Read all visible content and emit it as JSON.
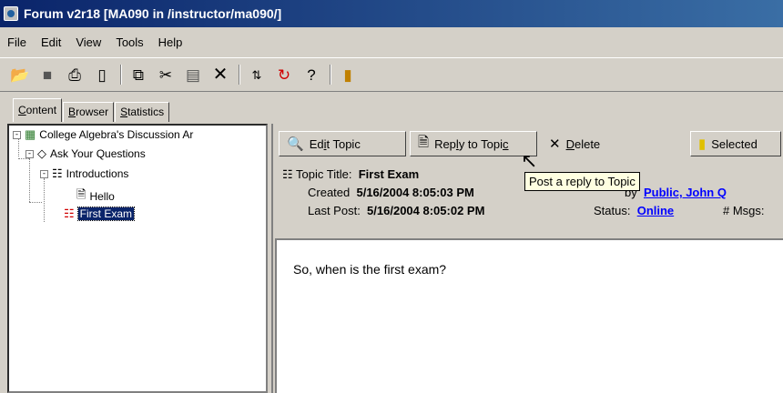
{
  "window": {
    "title": "Forum v2r18  [MA090 in /instructor/ma090/]"
  },
  "menu": [
    "File",
    "Edit",
    "View",
    "Tools",
    "Help"
  ],
  "toolbar": {
    "icons": [
      "open-folder-icon",
      "save-icon",
      "print-icon",
      "folder-icon",
      "copy-icon",
      "cut-icon",
      "paste-icon",
      "delete-icon",
      "sort-icon",
      "refresh-icon",
      "help-icon",
      "exit-icon"
    ]
  },
  "tabs": [
    {
      "label_underline": "C",
      "label_rest": "ontent"
    },
    {
      "label_underline": "B",
      "label_rest": "rowser"
    },
    {
      "label_underline": "S",
      "label_rest": "tatistics"
    }
  ],
  "tree": {
    "root": "College Algebra's Discussion Ar",
    "section": "Ask Your Questions",
    "folder": "Introductions",
    "item_hello": "Hello",
    "item_first_exam": "First Exam"
  },
  "actions": {
    "edit_pre": "Ed",
    "edit_u": "i",
    "edit_post": "t Topic",
    "reply_pre": "Rep",
    "reply_u": "l",
    "reply_mid": "y to Topi",
    "reply_u2": "c",
    "delete_u": "D",
    "delete_rest": "elete",
    "selected": "Selected"
  },
  "topic": {
    "title_label": "Topic Title:",
    "title_value": "First Exam",
    "created_label": "Created",
    "created_value": "5/16/2004 8:05:03 PM",
    "by_label": "by",
    "by_value": "Public, John Q",
    "lastpost_label": "Last Post:",
    "lastpost_value": "5/16/2004 8:05:02 PM",
    "status_label": "Status:",
    "status_value": "Online",
    "msgs_label": "# Msgs:"
  },
  "tooltip": "Post a reply to Topic",
  "message": {
    "body": "So, when is the first exam?"
  }
}
